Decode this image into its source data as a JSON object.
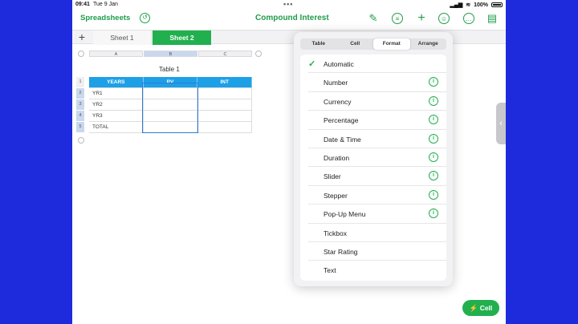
{
  "status": {
    "time": "09:41",
    "date": "Tue 9 Jan",
    "battery": "100%"
  },
  "toolbar": {
    "back_label": "Spreadsheets",
    "title": "Compound Interest"
  },
  "sheets": {
    "add": "+",
    "tabs": [
      "Sheet 1",
      "Sheet 2"
    ],
    "active": "Sheet 2"
  },
  "table": {
    "title": "Table 1",
    "columns": [
      "A",
      "B",
      "C"
    ],
    "header": [
      "YEARS",
      "PV",
      "INT"
    ],
    "rows": [
      [
        "YR1",
        "",
        ""
      ],
      [
        "YR2",
        "",
        ""
      ],
      [
        "YR3",
        "",
        ""
      ],
      [
        "TOTAL",
        "",
        ""
      ]
    ],
    "row_numbers": [
      "1",
      "2",
      "3",
      "4",
      "5"
    ]
  },
  "popover": {
    "tabs": [
      "Table",
      "Cell",
      "Format",
      "Arrange"
    ],
    "active_tab": "Format",
    "formats": [
      {
        "label": "Automatic",
        "checked": true,
        "info": false
      },
      {
        "label": "Number",
        "checked": false,
        "info": true
      },
      {
        "label": "Currency",
        "checked": false,
        "info": true
      },
      {
        "label": "Percentage",
        "checked": false,
        "info": true
      },
      {
        "label": "Date & Time",
        "checked": false,
        "info": true
      },
      {
        "label": "Duration",
        "checked": false,
        "info": true
      },
      {
        "label": "Slider",
        "checked": false,
        "info": true
      },
      {
        "label": "Stepper",
        "checked": false,
        "info": true
      },
      {
        "label": "Pop-Up Menu",
        "checked": false,
        "info": true
      },
      {
        "label": "Tickbox",
        "checked": false,
        "info": false
      },
      {
        "label": "Star Rating",
        "checked": false,
        "info": false
      },
      {
        "label": "Text",
        "checked": false,
        "info": false
      }
    ]
  },
  "cell_button": "Cell",
  "colors": {
    "accent": "#22b04f",
    "header_blue": "#1ea0e6",
    "frame": "#1d2bdc"
  }
}
